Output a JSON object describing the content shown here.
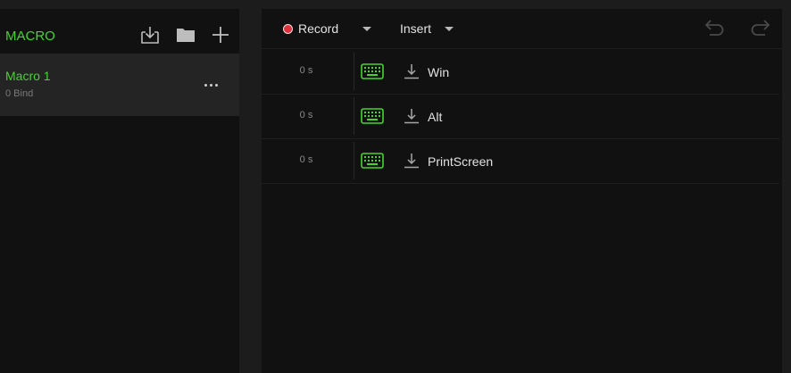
{
  "sidebar": {
    "title": "MACRO",
    "icons": {
      "import": "import-icon",
      "folder": "folder-icon",
      "add": "add-icon"
    },
    "macros": [
      {
        "name": "Macro 1",
        "bind": "0 Bind",
        "selected": true
      }
    ]
  },
  "toolbar": {
    "record_label": "Record",
    "insert_label": "Insert",
    "undo_icon": "undo-icon",
    "redo_icon": "redo-icon"
  },
  "events": [
    {
      "delay": "0 s",
      "device_icon": "keyboard-icon",
      "action_icon": "key-down-icon",
      "key": "Win"
    },
    {
      "delay": "0 s",
      "device_icon": "keyboard-icon",
      "action_icon": "key-down-icon",
      "key": "Alt"
    },
    {
      "delay": "0 s",
      "device_icon": "keyboard-icon",
      "action_icon": "key-down-icon",
      "key": "PrintScreen"
    }
  ],
  "colors": {
    "accent": "#44d62c",
    "background": "#1c1c1c",
    "panel": "#111111",
    "selected_item": "#242424",
    "record_dot": "#e0303a"
  }
}
